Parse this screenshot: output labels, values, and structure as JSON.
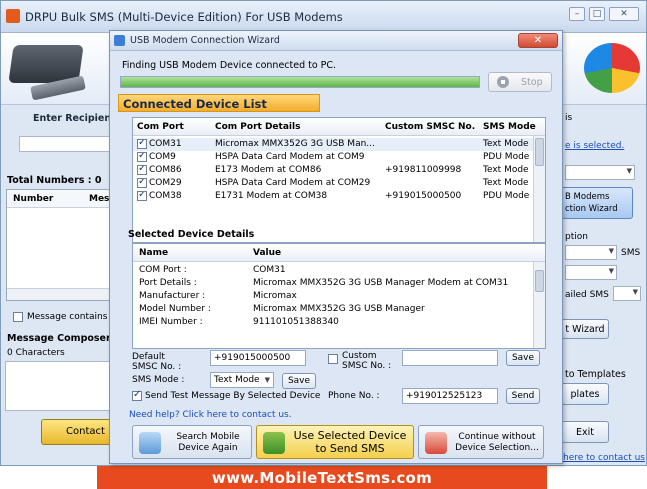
{
  "main": {
    "title": "DRPU Bulk SMS (Multi-Device Edition) For USB Modems",
    "enter_recipient": "Enter Recipien",
    "total_numbers": "Total Numbers : 0",
    "grid_cols": [
      "Number",
      "Mes"
    ],
    "message_contains": "Message contains",
    "message_composer": "Message Composer :",
    "chars": "0 Characters",
    "contact_button": "Contact u",
    "right": {
      "ms_text": "is",
      "selected_text": "e is selected.",
      "usb_modems": "B Modems",
      "connection_wizard": "ction  Wizard",
      "option": "ption",
      "sms": "SMS",
      "failed_sms": "ailed SMS",
      "wizard_btn": "t Wizard",
      "to_templates": "to Templates",
      "templates_btn": "plates",
      "exit_btn": "Exit",
      "contact_link": "here to contact us"
    },
    "banner": "www.MobileTextSms.com"
  },
  "dialog": {
    "title": "USB Modem Connection Wizard",
    "status": "Finding USB Modem Device connected to PC.",
    "progress": 1.0,
    "stop_label": "Stop",
    "connected_header": "Connected Device List",
    "device_columns": [
      "Com Port",
      "Com Port Details",
      "Custom SMSC No.",
      "SMS Mode"
    ],
    "devices": [
      {
        "port": "COM31",
        "details": "Micromax MMX352G 3G USB Man...",
        "smsc": "",
        "mode": "Text Mode",
        "checked": true
      },
      {
        "port": "COM9",
        "details": "HSPA Data Card Modem at COM9",
        "smsc": "",
        "mode": "PDU Mode",
        "checked": true
      },
      {
        "port": "COM86",
        "details": "E173 Modem at COM86",
        "smsc": "+919811009998",
        "mode": "Text Mode",
        "checked": true
      },
      {
        "port": "COM29",
        "details": "HSPA Data Card Modem at COM29",
        "smsc": "",
        "mode": "Text Mode",
        "checked": true
      },
      {
        "port": "COM38",
        "details": "E1731 Modem at COM38",
        "smsc": "+919015000500",
        "mode": "PDU Mode",
        "checked": true
      }
    ],
    "selected_title": "Selected Device Details",
    "detail_columns": [
      "Name",
      "Value"
    ],
    "details": [
      {
        "name": "COM Port :",
        "value": "COM31"
      },
      {
        "name": "Port Details :",
        "value": "Micromax MMX352G 3G USB Manager Modem at COM31"
      },
      {
        "name": "Manufacturer :",
        "value": "Micromax"
      },
      {
        "name": "Model Number :",
        "value": "Micromax MMX352G 3G USB Manager"
      },
      {
        "name": "IMEI Number :",
        "value": "911101051388340"
      }
    ],
    "default_smsc_label_1": "Default",
    "default_smsc_label_2": "SMSC No. :",
    "default_smsc_value": "+919015000500",
    "custom_smsc_label_1": "Custom",
    "custom_smsc_label_2": "SMSC No. :",
    "custom_smsc_value": "",
    "save_label": "Save",
    "sms_mode_label": "SMS Mode :",
    "sms_mode_value": "Text Mode",
    "send_test_label": "Send Test Message By Selected Device",
    "phone_label": "Phone No. :",
    "phone_value": "+919012525123",
    "send_label": "Send",
    "help_link": "Need help? Click here to contact us.",
    "search_again": [
      "Search Mobile",
      "Device Again"
    ],
    "use_selected": [
      "Use Selected Device",
      "to Send SMS"
    ],
    "continue_without": [
      "Continue without",
      "Device Selection..."
    ]
  }
}
